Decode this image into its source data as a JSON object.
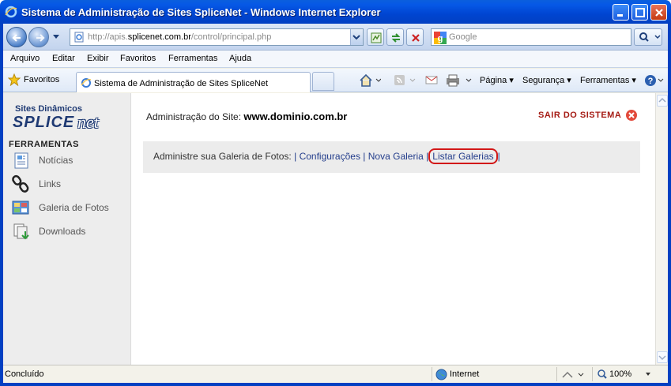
{
  "window": {
    "title": "Sistema de Administração de Sites SpliceNet - Windows Internet Explorer"
  },
  "address_bar": {
    "url_prefix": "http://apis.",
    "url_domain": "splicenet.com.br",
    "url_path": "/control/principal.php"
  },
  "search": {
    "placeholder": "Google"
  },
  "menu": [
    "Arquivo",
    "Editar",
    "Exibir",
    "Favoritos",
    "Ferramentas",
    "Ajuda"
  ],
  "favorites_bar": {
    "favorites_label": "Favoritos",
    "tab_title": "Sistema de Administração de Sites SpliceNet",
    "commands": {
      "page": "Página",
      "security": "Segurança",
      "tools": "Ferramentas"
    }
  },
  "sidebar": {
    "logo_line1": "Sites Dinâmicos",
    "logo_line2": "SPLICE",
    "logo_line3": "net",
    "section_title": "FERRAMENTAS",
    "items": [
      {
        "label": "Notícias",
        "icon": "news-icon"
      },
      {
        "label": "Links",
        "icon": "link-chain-icon"
      },
      {
        "label": "Galeria de Fotos",
        "icon": "photo-gallery-icon"
      },
      {
        "label": "Downloads",
        "icon": "downloads-icon"
      }
    ]
  },
  "main": {
    "site_label": "Administração do Site:",
    "site_domain": "www.dominio.com.br",
    "logout_label": "SAIR DO SISTEMA",
    "gallery_bar": {
      "prefix": "Administre sua Galeria de Fotos:",
      "links": [
        "Configurações",
        "Nova Galeria",
        "Listar Galerias"
      ],
      "separator": "|"
    }
  },
  "statusbar": {
    "status": "Concluído",
    "zone": "Internet",
    "zoom": "100%"
  },
  "colors": {
    "titlebar": "#0045d1",
    "link": "#243e8c",
    "logout": "#a51b14",
    "highlight": "#d21717"
  }
}
